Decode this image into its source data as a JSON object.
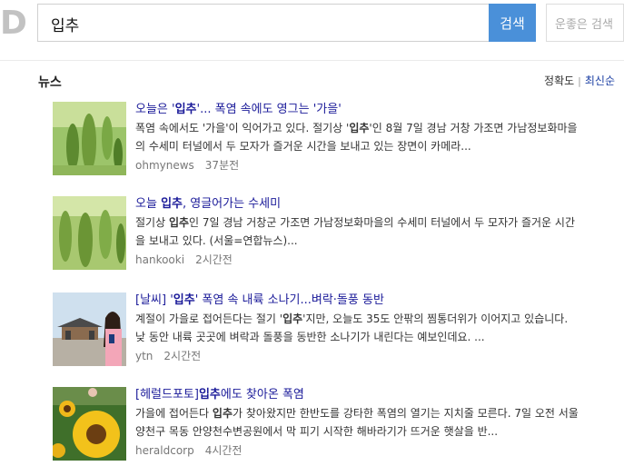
{
  "search": {
    "query": "입추",
    "button_label": "검색",
    "lucky_label": "운좋은 검색"
  },
  "logo": {
    "text": "D"
  },
  "news": {
    "section_title": "뉴스",
    "sort": {
      "relevance": "정확도",
      "sep": "|",
      "latest": "최신순"
    },
    "items": [
      {
        "title_pre": "오늘은 '",
        "title_bold": "입추",
        "title_post": "'... 폭염 속에도 영그는 '가을'",
        "snippet_line1_pre": "폭염 속에서도 '가을'이 익어가고 있다. 절기상 '",
        "snippet_line1_bold": "입추",
        "snippet_line1_post": "'인 8월 7일 경남 거창 가조면 가남정보화마을",
        "snippet_line2": "의 수세미 터널에서 두 모자가 즐거운 시간을 보내고 있는 장면이 카메라...",
        "source": "ohmynews",
        "time": "37분전"
      },
      {
        "title_pre": "오늘 ",
        "title_bold": "입추",
        "title_post": ", 영글어가는 수세미",
        "snippet_line1_pre": "절기상 ",
        "snippet_line1_bold": "입추",
        "snippet_line1_post": "인 7일 경남 거창군 가조면 가남정보화마을의 수세미 터널에서 두 모자가 즐거운 시간",
        "snippet_line2": "을 보내고 있다. (서울=연합뉴스)...",
        "source": "hankooki",
        "time": "2시간전"
      },
      {
        "title_pre": "[날씨] '",
        "title_bold": "입추",
        "title_post": "' 폭염 속 내륙 소나기...벼락·돌풍 동반",
        "snippet_line1_pre": "계절이 가을로 접어든다는 절기 '",
        "snippet_line1_bold": "입추",
        "snippet_line1_post": "'지만, 오늘도 35도 안팎의 찜통더위가 이어지고 있습니다.",
        "snippet_line2": "낮 동안 내륙 곳곳에 벼락과 돌풍을 동반한 소나기가 내린다는 예보인데요. ...",
        "source": "ytn",
        "time": "2시간전"
      },
      {
        "title_pre": "[헤럴드포토]",
        "title_bold": "입추",
        "title_post": "에도 찾아온 폭염",
        "snippet_line1_pre": "가을에 접어든다 ",
        "snippet_line1_bold": "입추",
        "snippet_line1_post": "가 찾아왔지만 한반도를 강타한 폭염의 열기는 지치줄 모른다. 7일 오전 서울",
        "snippet_line2": "양천구 목동 안양천수변공원에서 막 피기 시작한 해바라기가 뜨거운 햇살을 반...",
        "source": "heraldcorp",
        "time": "4시간전"
      }
    ]
  },
  "colors": {
    "accent": "#4a90d9",
    "title_link": "#1a1a99"
  }
}
